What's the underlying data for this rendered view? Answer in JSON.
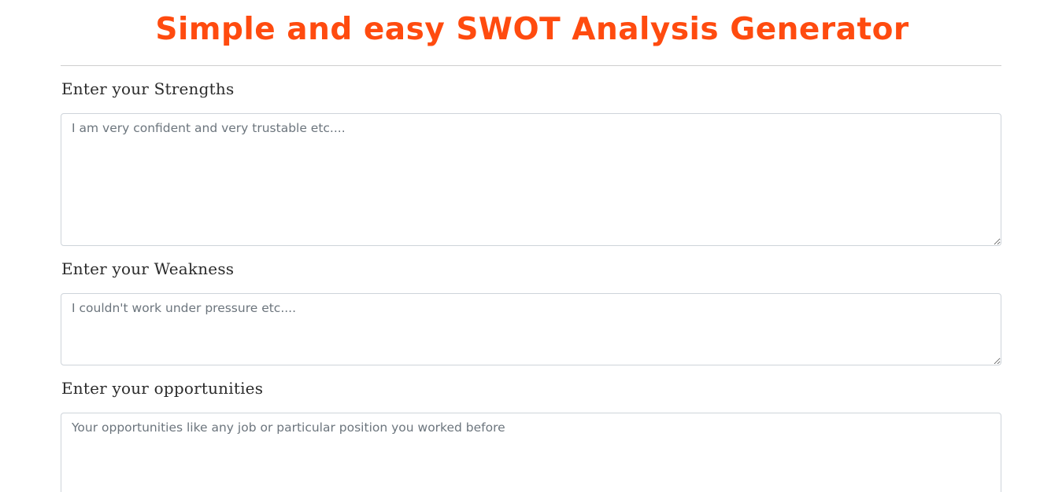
{
  "header": {
    "title": "Simple and easy SWOT Analysis Generator",
    "title_color": "#ff4b0f"
  },
  "form": {
    "strengths": {
      "label": "Enter your Strengths",
      "placeholder": "I am very confident and very trustable etc....",
      "value": ""
    },
    "weakness": {
      "label": "Enter your Weakness",
      "placeholder": "I couldn't work under pressure etc....",
      "value": ""
    },
    "opportunities": {
      "label": "Enter your opportunities",
      "placeholder": "Your opportunities like any job or particular position you worked before",
      "value": ""
    }
  },
  "colors": {
    "label_text": "#2b2b2b",
    "field_border": "#ced4da",
    "placeholder_text": "#6c757d",
    "divider": "#cfcfcf"
  }
}
